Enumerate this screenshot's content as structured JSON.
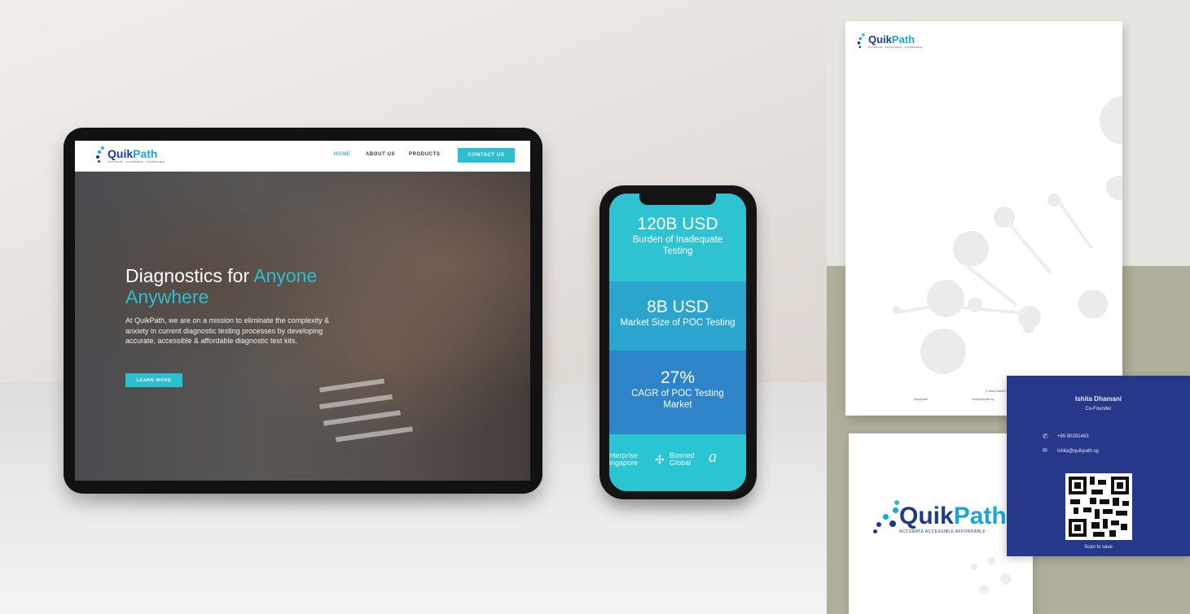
{
  "website": {
    "brand": {
      "part1": "Quik",
      "part2": "Path",
      "tagline": "ACCURATE · ACCESSIBLE · AFFORDABLE"
    },
    "nav": {
      "home": "HOME",
      "about": "ABOUT US",
      "products": "PRODUCTS",
      "contact": "CONTACT US"
    },
    "hero": {
      "title_part1": "Diagnostics for ",
      "title_accent1": "Anyone",
      "title_accent2": "Anywhere",
      "body": "At QuikPath, we are on a mission to eliminate the complexity & anxiety in current diagnostic testing processes by developing accurate, accessible & affordable diagnostic test kits.",
      "button": "LEARN MORE"
    }
  },
  "phone": {
    "stats": [
      {
        "value": "120B USD",
        "label": "Burden of Inadequate Testing"
      },
      {
        "value": "8B USD",
        "label": "Market Size of POC Testing"
      },
      {
        "value": "27%",
        "label": "CAGR of POC Testing Market"
      }
    ],
    "partners": {
      "p1_line1": "nterprise",
      "p1_line2": "ingapore",
      "p2_line1": "Biomed",
      "p2_line2": "Global",
      "p3": "a"
    }
  },
  "letterhead": {
    "brand": {
      "part1": "Quik",
      "part2": "Path",
      "tagline": "ACCURATE · ACCESSIBLE · AFFORDABLE"
    },
    "footer": {
      "address": "21 Bukit Batok Crescent, #11-83, Singapore",
      "social": "@quikpath",
      "email": "info@quikpath.sg"
    }
  },
  "business_card": {
    "front": {
      "part1": "Quik",
      "part2": "Path",
      "tagline": "ACCURATE  ACCESSIBLE  AFFORDABLE"
    },
    "back": {
      "name": "Ishita Dhamani",
      "title": "Co-Founder",
      "phone": "+65 90291483",
      "email": "ishita@quikpath.sg",
      "qr_caption": "Scan to save"
    }
  },
  "colors": {
    "teal": "#2bbfcf",
    "navy": "#26388a",
    "brand_blue": "#1ba7d6"
  }
}
